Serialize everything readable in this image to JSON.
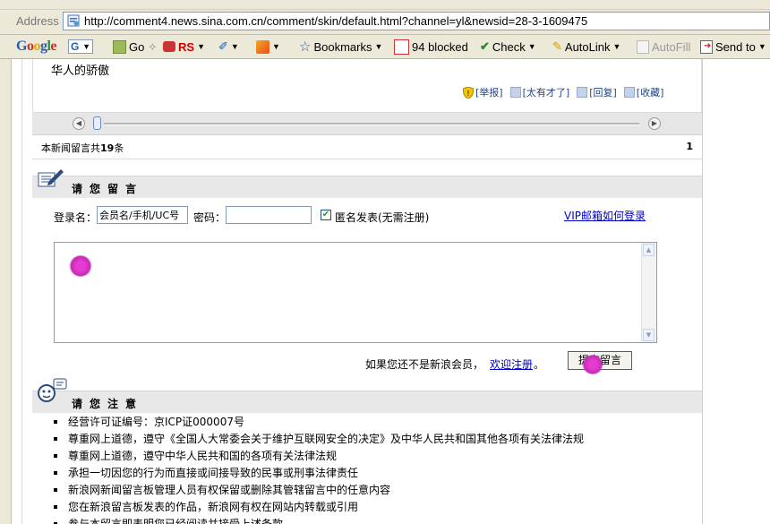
{
  "browser": {
    "address_label": "Address",
    "url": "http://comment4.news.sina.com.cn/comment/skin/default.html?channel=yl&newsid=28-3-1609475",
    "toolbar": {
      "google_logo": "Google",
      "search_box_letter": "G",
      "go_label": "Go",
      "rs_label": "RS",
      "bookmarks_label": "Bookmarks",
      "blocked_label": "94 blocked",
      "check_label": "Check",
      "autolink_label": "AutoLink",
      "autofill_label": "AutoFill",
      "sendto_label": "Send to"
    }
  },
  "previous_comment": {
    "text": "华人的骄傲",
    "actions": [
      "[举报]",
      "[太有才了]",
      "[回复]",
      "[收藏]"
    ]
  },
  "pagination": {
    "count_prefix": "本新闻留言共",
    "count_value": "19",
    "count_suffix": "条",
    "page_number": "1"
  },
  "comment_form": {
    "section_title": "请您留言",
    "login_label": "登录名：",
    "username_value": "会员名/手机/UC号",
    "password_label": "密码：",
    "password_value": "",
    "anonymous_checked": true,
    "anonymous_label": "匿名发表(无需注册)",
    "vip_link": "VIP邮箱如何登录",
    "comment_value": "",
    "not_member_text": "如果您还不是新浪会员，",
    "register_link": "欢迎注册",
    "register_suffix": "。",
    "submit_label": "提交留言"
  },
  "notice": {
    "section_title": "请您注意",
    "items": [
      "经营许可证编号：京ICP证000007号",
      "尊重网上道德，遵守《全国人大常委会关于维护互联网安全的决定》及中华人民共和国其他各项有关法律法规",
      "尊重网上道德，遵守中华人民共和国的各项有关法律法规",
      "承担一切因您的行为而直接或间接导致的民事或刑事法律责任",
      "新浪网新闻留言板管理人员有权保留或删除其管辖留言中的任意内容",
      "您在新浪留言板发表的作品，新浪网有权在网站内转载或引用",
      "参与本留言即表明您已经阅读并接受上述条款"
    ]
  },
  "colors": {
    "chrome": "#ece9d8",
    "section_bar": "#e8e8e8",
    "link": "#0000cc",
    "cursor_highlight": "#e63ad0"
  }
}
